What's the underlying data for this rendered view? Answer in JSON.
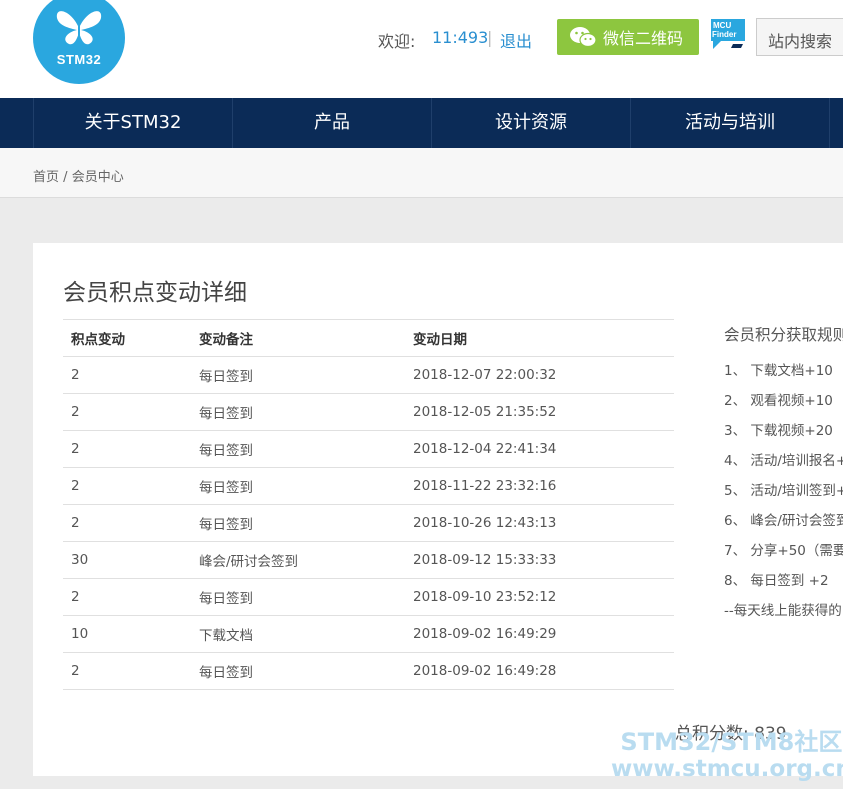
{
  "header": {
    "logo_text": "STM32",
    "welcome_label": "欢迎:",
    "username": "11:493",
    "separator": "|",
    "logout_label": "退出",
    "wechat_label": "微信二维码",
    "mcu_finder_text1": "MCU",
    "mcu_finder_text2": "Finder",
    "search_label": "站内搜索"
  },
  "nav": {
    "items": [
      "关于STM32",
      "产品",
      "设计资源",
      "活动与培训"
    ]
  },
  "breadcrumb": {
    "home": "首页",
    "sep": "/",
    "current": "会员中心"
  },
  "main": {
    "title": "会员积点变动详细",
    "table": {
      "headers": [
        "积点变动",
        "变动备注",
        "变动日期"
      ],
      "rows": [
        [
          "2",
          "每日签到",
          "2018-12-07 22:00:32"
        ],
        [
          "2",
          "每日签到",
          "2018-12-05 21:35:52"
        ],
        [
          "2",
          "每日签到",
          "2018-12-04 22:41:34"
        ],
        [
          "2",
          "每日签到",
          "2018-11-22 23:32:16"
        ],
        [
          "2",
          "每日签到",
          "2018-10-26 12:43:13"
        ],
        [
          "30",
          "峰会/研讨会签到",
          "2018-09-12 15:33:33"
        ],
        [
          "2",
          "每日签到",
          "2018-09-10 23:52:12"
        ],
        [
          "10",
          "下载文档",
          "2018-09-02 16:49:29"
        ],
        [
          "2",
          "每日签到",
          "2018-09-02 16:49:28"
        ]
      ]
    },
    "rules": {
      "title": "会员积分获取规则",
      "items": [
        "1、 下载文档+10",
        "2、 观看视频+10",
        "3、 下载视频+20",
        "4、 活动/培训报名+",
        "5、 活动/培训签到+",
        "6、 峰会/研讨会签到",
        "7、 分享+50（需要",
        "8、 每日签到 +2"
      ],
      "note": "--每天线上能获得的"
    },
    "total_label": "总积分数:",
    "total_value": "839"
  },
  "watermark": {
    "line1": "STM32/STM8社区",
    "line2": "www.stmcu.org.cn"
  },
  "colors": {
    "nav_bg": "#0b2b57",
    "logo_blue": "#2aa7df",
    "wechat_green": "#8dc63f",
    "link_blue": "#2a8fd0"
  }
}
